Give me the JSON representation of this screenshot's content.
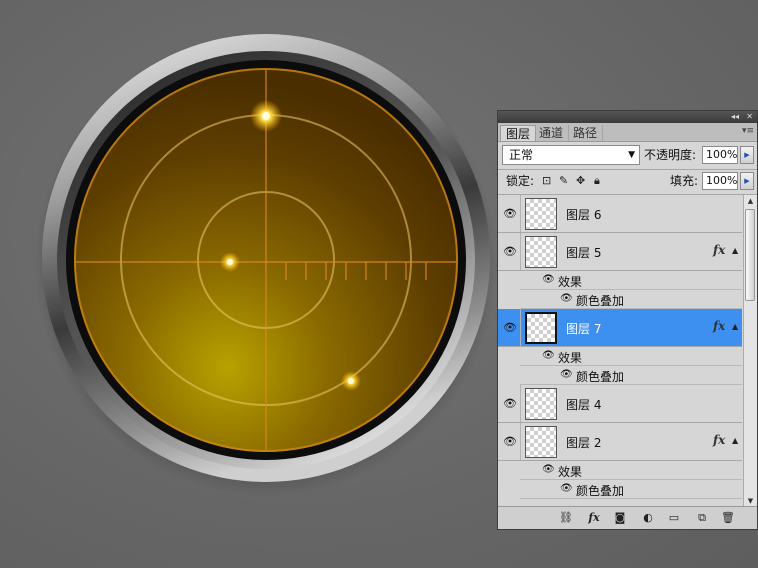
{
  "layers_panel": {
    "tabs": [
      "图层",
      "通道",
      "路径"
    ],
    "blend_mode": "正常",
    "opacity_label": "不透明度:",
    "opacity_value": "100%",
    "lock_label": "锁定:",
    "fill_label": "填充:",
    "fill_value": "100%",
    "layers": [
      {
        "name": "图层 6",
        "has_fx": false,
        "selected": false
      },
      {
        "name": "图层 5",
        "has_fx": true,
        "selected": false,
        "effects_label": "效果",
        "effect": "颜色叠加"
      },
      {
        "name": "图层 7",
        "has_fx": true,
        "selected": true,
        "effects_label": "效果",
        "effect": "颜色叠加"
      },
      {
        "name": "图层 4",
        "has_fx": false,
        "selected": false
      },
      {
        "name": "图层 2",
        "has_fx": true,
        "selected": false,
        "effects_label": "效果",
        "effect": "颜色叠加"
      }
    ],
    "fx_label": "fx",
    "bottom_icons": [
      "link-icon",
      "fx-icon",
      "mask-icon",
      "adjustment-icon",
      "group-folder-icon",
      "new-layer-icon",
      "trash-icon"
    ]
  },
  "colors": {
    "radar_glow": "#ffcc33",
    "radar_line": "#e08a1a",
    "selected_layer": "#3d8ff0"
  }
}
